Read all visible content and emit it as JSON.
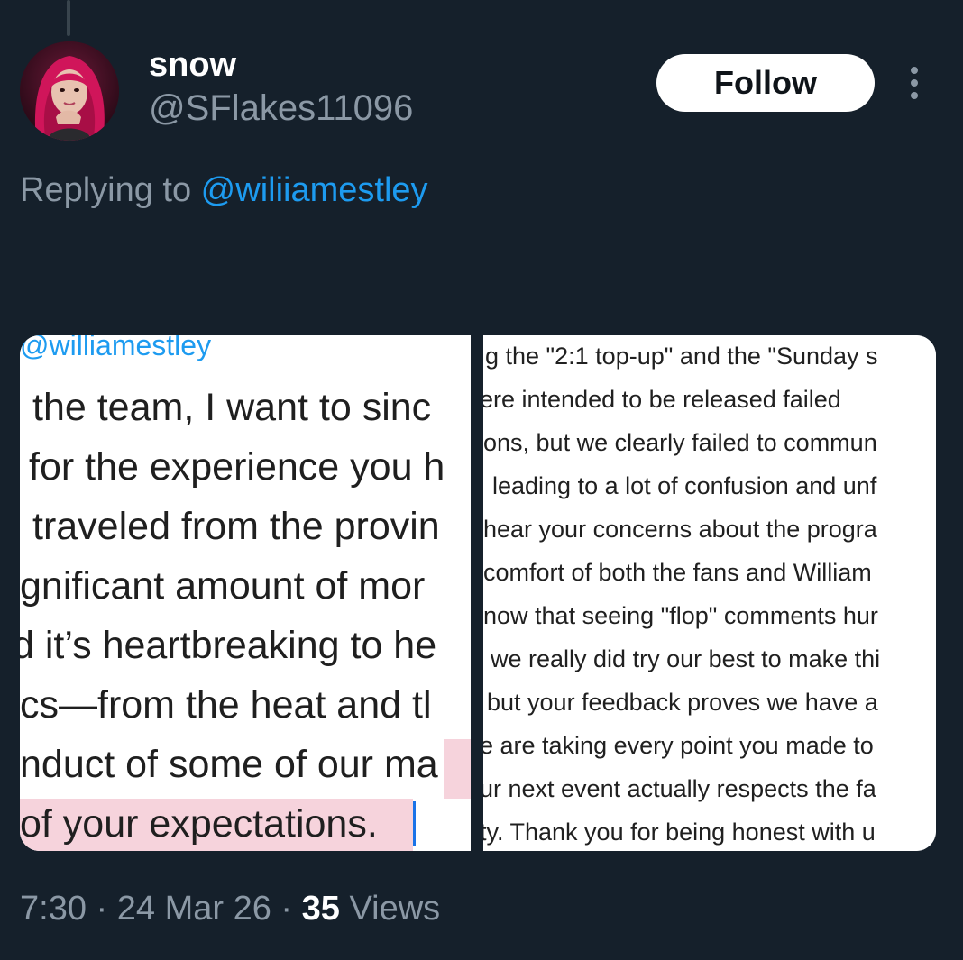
{
  "author": {
    "display_name": "snow",
    "handle": "@SFlakes11096",
    "avatar_icon": "profile-photo"
  },
  "follow_label": "Follow",
  "more_icon": "more-vertical-icon",
  "reply_context": {
    "prefix": "Replying to ",
    "mention": "@wiliiamestley"
  },
  "media": {
    "left_image": {
      "mention": "@williamestley",
      "lines": [
        "the team, I want to sinc",
        "for the experience you h",
        "traveled from the provin",
        "gnificant amount of mor",
        "d it’s heartbreaking to he",
        "cs—from the heat and tl",
        "nduct of some of our ma",
        "of your expectations."
      ]
    },
    "right_image": {
      "lines": [
        "g the \"2:1 top-up\" and the \"Sunday s",
        "ere intended to be released failed",
        "ons, but we clearly failed to commun",
        "leading to a lot of confusion and unf",
        "hear your concerns about the progra",
        "comfort of both the fans and William",
        "now that seeing \"flop\" comments hur",
        "we really did try our best to make thi",
        "but your feedback proves we have a",
        "e are taking every point you made to",
        "ur next event actually respects the fa",
        "ty. Thank you for being honest with u"
      ]
    }
  },
  "meta": {
    "time": "7:30",
    "sep1": " · ",
    "date": "24 Mar 26",
    "sep2": " · ",
    "views_count": "35",
    "views_label": " Views"
  },
  "colors": {
    "background": "#15202b",
    "accent": "#1d9bf0",
    "secondary_text": "#8b98a5",
    "highlight": "#f6d3dc"
  }
}
